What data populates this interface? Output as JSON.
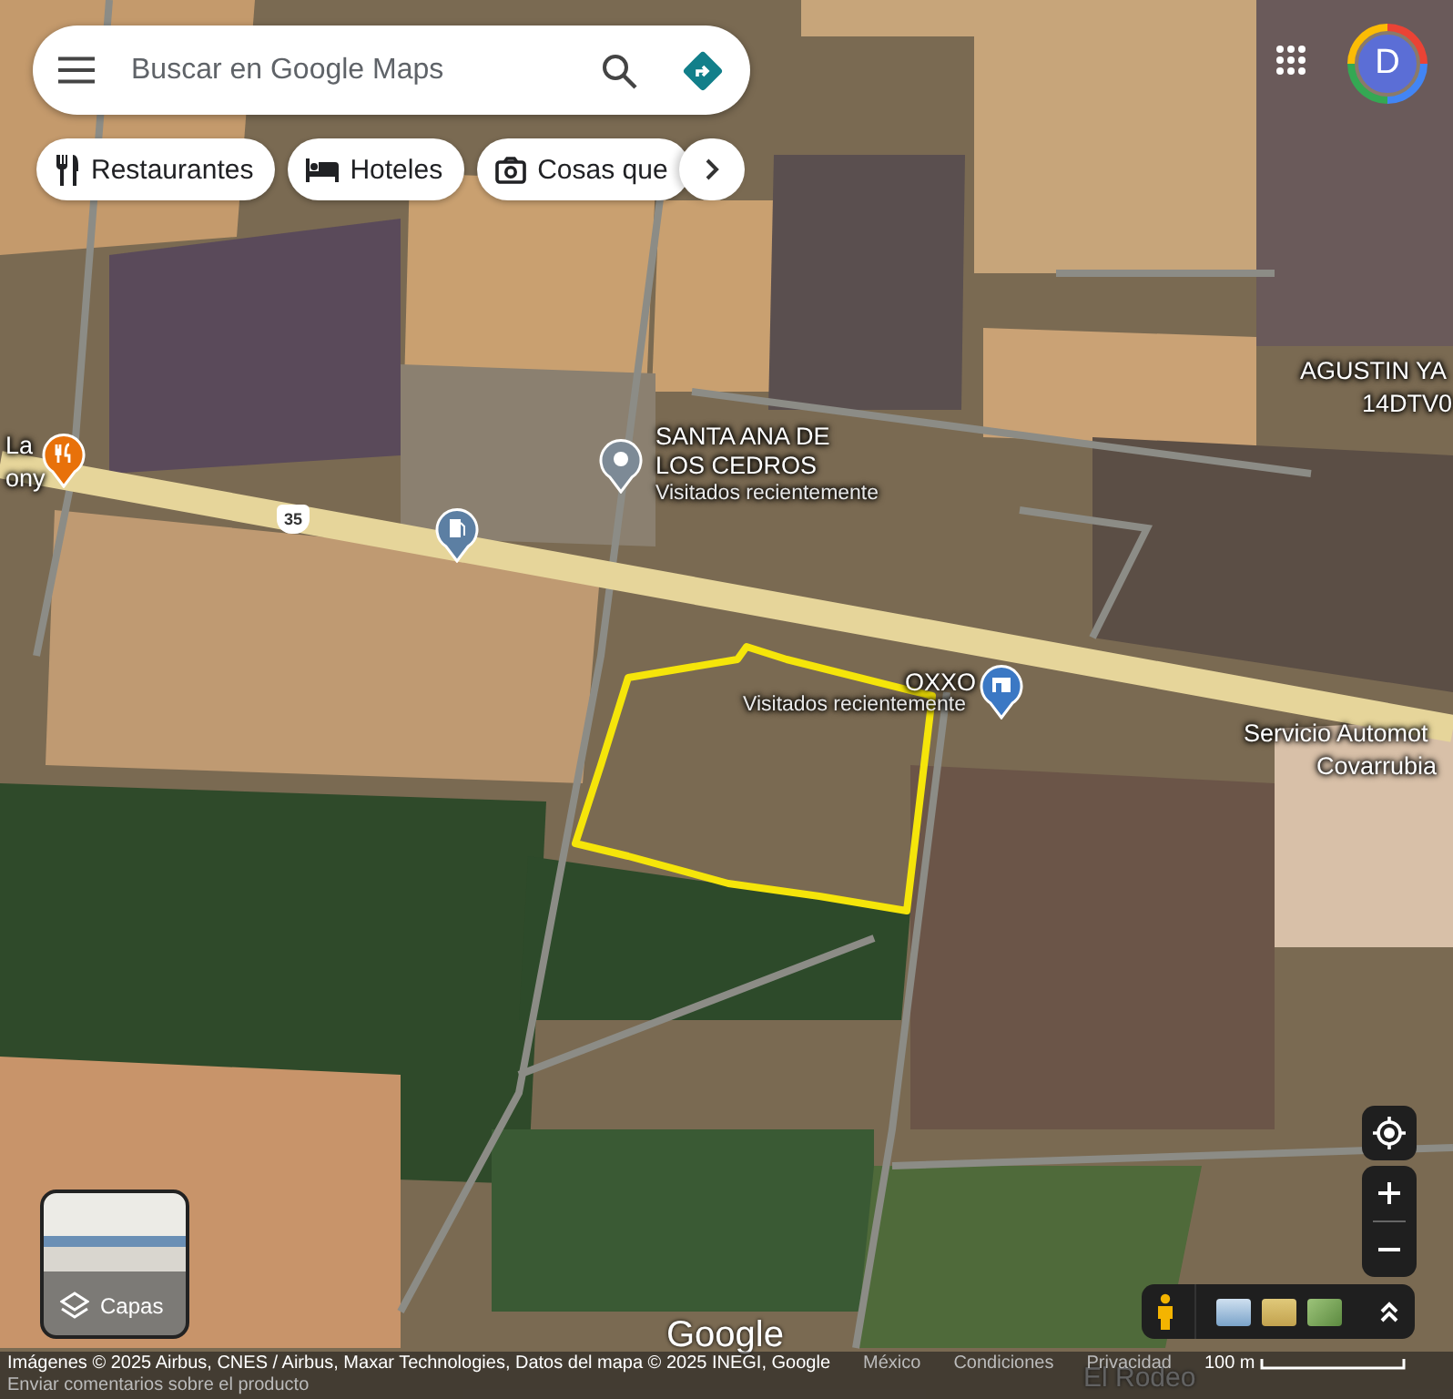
{
  "search": {
    "placeholder": "Buscar en Google Maps"
  },
  "account": {
    "letter": "D"
  },
  "chips": [
    {
      "label": "Restaurantes",
      "kind": "restaurant"
    },
    {
      "label": "Hoteles",
      "kind": "hotel"
    },
    {
      "label": "Cosas que",
      "kind": "things"
    }
  ],
  "map_labels": [
    {
      "text": "La",
      "kind": "title"
    },
    {
      "text": "ony",
      "kind": "title"
    },
    {
      "text": "SANTA ANA DE LOS CEDROS",
      "kind": "title"
    },
    {
      "text": "Visitados recientemente",
      "kind": "subtitle"
    },
    {
      "text": "AGUSTIN YA",
      "kind": "title"
    },
    {
      "text": "14DTV0",
      "kind": "title"
    },
    {
      "text": "OXXO",
      "kind": "title"
    },
    {
      "text": "Visitados recientemente",
      "kind": "subtitle"
    },
    {
      "text": "Servicio Automot",
      "kind": "title"
    },
    {
      "text": "Covarrubia",
      "kind": "title"
    },
    {
      "text": "El Rodeo",
      "kind": "faint"
    }
  ],
  "highway_shield": "35",
  "layers": {
    "label": "Capas"
  },
  "google_logo": "Google",
  "footer": {
    "attribution": "Imágenes © 2025 Airbus, CNES / Airbus, Maxar Technologies, Datos del mapa © 2025 INEGI, Google",
    "links": [
      "México",
      "Condiciones",
      "Privacidad"
    ],
    "scale": "100 m",
    "feedback": "Enviar comentarios sobre el producto"
  }
}
